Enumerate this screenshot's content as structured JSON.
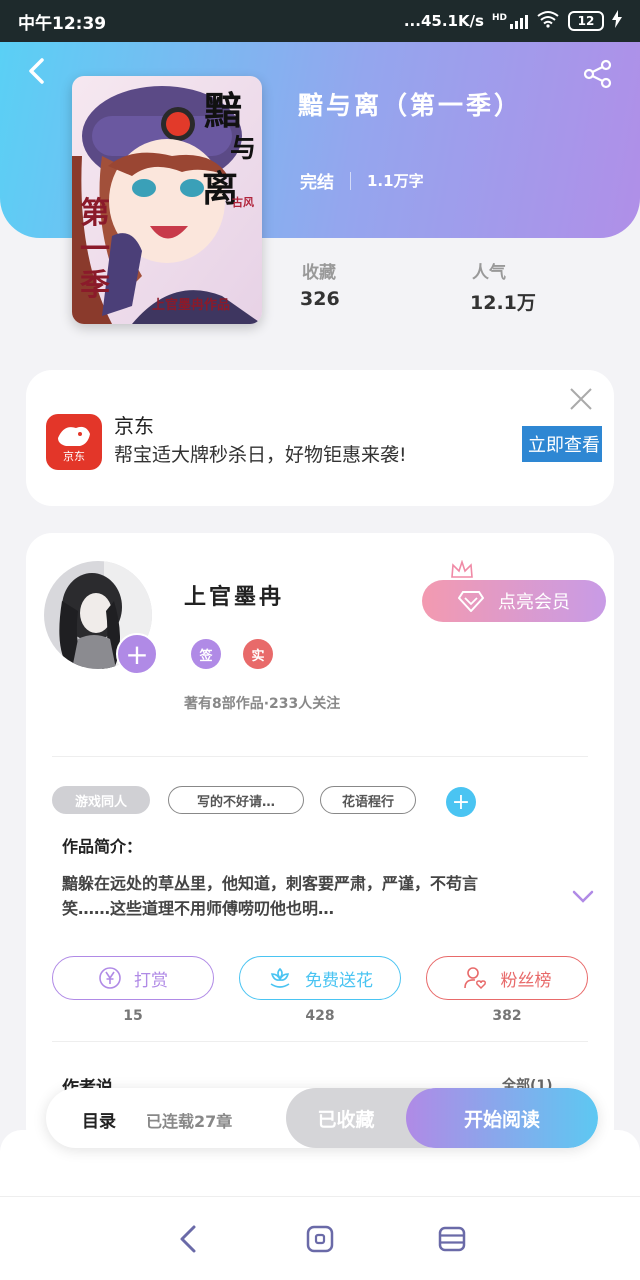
{
  "status_bar": {
    "time": "中午12:39",
    "network_speed": "...45.1K/s",
    "network_type": "HD",
    "battery": "12"
  },
  "book": {
    "title": "黯与离（第一季）",
    "status": "完结",
    "word_count": "1.1万字",
    "favorites_label": "收藏",
    "favorites_value": "326",
    "popularity_label": "人气",
    "popularity_value": "12.1万",
    "cover_text": {
      "line1": "黯",
      "line2": "与",
      "line3": "离",
      "season": "第一季",
      "credit": "上官墨冉作品",
      "genre": "古风"
    }
  },
  "ad": {
    "brand": "京东",
    "logo_text": "京东",
    "description": "帮宝适大牌秒杀日，好物钜惠来袭!",
    "cta": "立即查看"
  },
  "author": {
    "name": "上官墨冉",
    "vip_label": "点亮会员",
    "badges": [
      "签",
      "实"
    ],
    "stats": "著有8部作品·233人关注",
    "tags": [
      "游戏同人",
      "写的不好请…",
      "花语程行"
    ],
    "intro_title": "作品简介：",
    "intro_text": "黯躲在远处的草丛里，他知道，刺客要严肃，严谨，不苟言笑……这些道理不用师傅唠叨他也明…",
    "actions": [
      {
        "label": "打赏",
        "count": "15"
      },
      {
        "label": "免费送花",
        "count": "428"
      },
      {
        "label": "粉丝榜",
        "count": "382"
      }
    ],
    "author_say": "作者说",
    "see_all": "全部(1)"
  },
  "bottom_bar": {
    "toc_label": "目录",
    "toc_status": "已连载27章",
    "collected": "已收藏",
    "start_reading": "开始阅读"
  },
  "colors": {
    "header_start": "#5ad0f5",
    "header_end": "#b08fe8",
    "accent_purple": "#b08ae6",
    "accent_blue": "#4ac4f2",
    "accent_red": "#e86a6a",
    "jd_red": "#e33629",
    "ad_button": "#2e87d3"
  }
}
